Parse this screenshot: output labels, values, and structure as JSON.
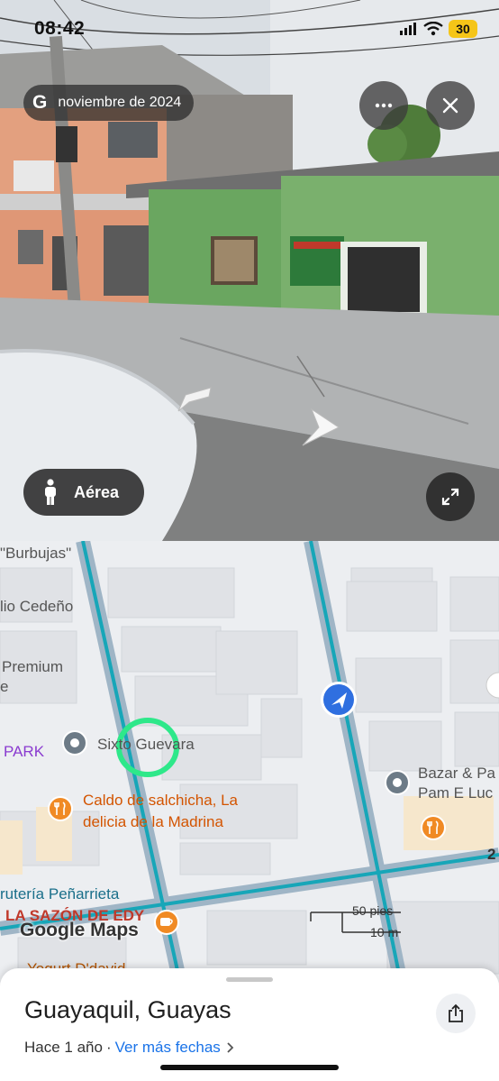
{
  "status_bar": {
    "time": "08:42",
    "battery": "30"
  },
  "street_view": {
    "date_logo": "G",
    "date": "noviembre de 2024",
    "more_icon": "ellipsis-icon",
    "close_icon": "close-icon",
    "aerial_label": "Aérea",
    "expand_icon": "expand-icon"
  },
  "map": {
    "labels": {
      "burbujas": "\"Burbujas\"",
      "cedeno": "lio Cedeño",
      "premium": "Premium",
      "premium_e": "e",
      "park": "PARK",
      "sixto": "Sixto Guevara",
      "caldo_line1": "Caldo de salchicha, La",
      "caldo_line2": "delicia de la Madrina",
      "fruteria": "rutería Peñarrieta",
      "sazon": "LA SAZÓN DE EDY",
      "yogurt": "Yogurt D'david",
      "bazar_line1": "Bazar & Pa",
      "bazar_line2": "Pam E Luc",
      "edge_number": "2"
    },
    "logo": "Google Maps",
    "scale_ft": "50 pies",
    "scale_m": "10 m"
  },
  "sheet": {
    "title": "Guayaquil, Guayas",
    "ago": "Hace 1 año",
    "separator": "·",
    "more_dates": "Ver más fechas"
  }
}
